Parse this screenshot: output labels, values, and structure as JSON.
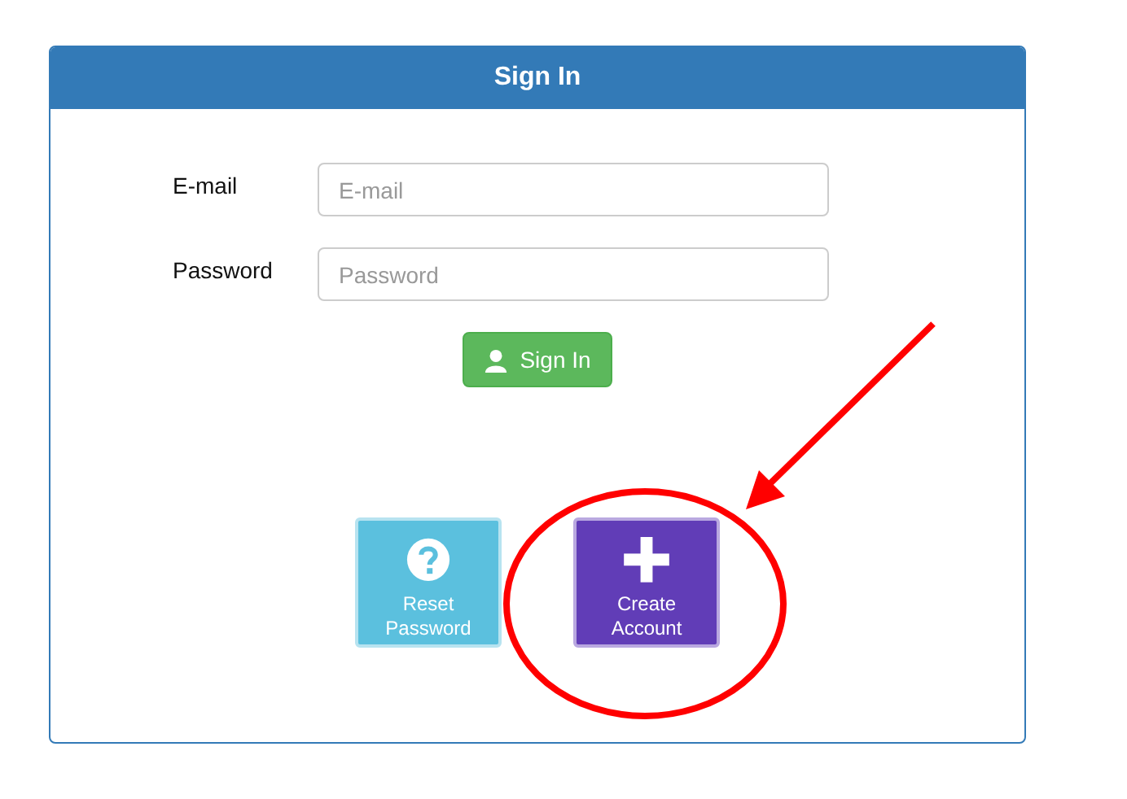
{
  "panel": {
    "title": "Sign In"
  },
  "fields": [
    {
      "label": "E-mail",
      "placeholder": "E-mail"
    },
    {
      "label": "Password",
      "placeholder": "Password"
    }
  ],
  "sign_in_button": {
    "label": "Sign In"
  },
  "tiles": [
    {
      "kind": "help",
      "label": "Reset Password"
    },
    {
      "kind": "create",
      "label": "Create Account"
    }
  ]
}
